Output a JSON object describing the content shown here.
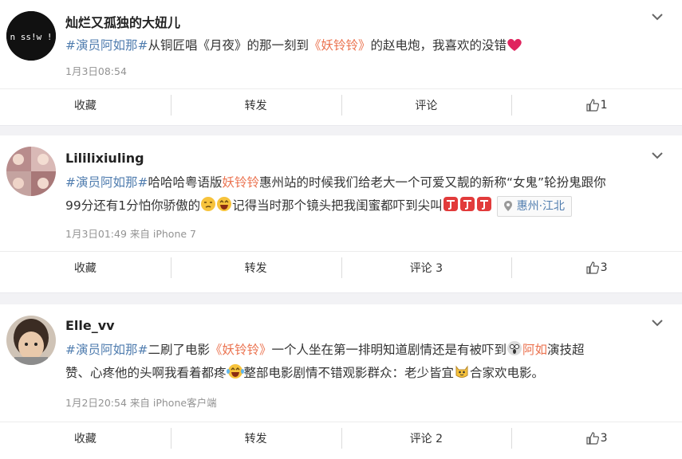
{
  "posts": [
    {
      "username": "灿烂又孤独的大妞儿",
      "avatar_text": "n ss!w !",
      "content": {
        "tag": "#演员阿如那#",
        "text": "从铜匠唱《月夜》的那一刻到",
        "movie": "《妖铃铃》",
        "text2": "的赵电炮，我喜欢的没错"
      },
      "meta": "1月3日08:54",
      "actions": {
        "favorite": "收藏",
        "repost": "转发",
        "comment": "评论",
        "like_count": "1"
      }
    },
    {
      "username": "Lililixiuling",
      "content": {
        "tag": "#演员阿如那#",
        "text_a": "哈哈哈粤语版",
        "movie": "妖铃铃",
        "text_b": "惠州站的时候我们给老大一个可爱又靓的新称“女鬼”轮扮鬼跟你",
        "text_c": "99分还有1分怕你骄傲的",
        "text_d": "记得当时那个镜头把我闺蜜都吓到尖叫",
        "location": "惠州·江北"
      },
      "meta": "1月3日01:49 来自 iPhone 7",
      "actions": {
        "favorite": "收藏",
        "repost": "转发",
        "comment": "评论 3",
        "like_count": "3"
      }
    },
    {
      "username": "Elle_vv",
      "content": {
        "tag": "#演员阿如那#",
        "text_a": "二刷了电影",
        "movie": "《妖铃铃》",
        "text_b": "一个人坐在第一排明知道剧情还是有被吓到",
        "name": "阿如",
        "text_c": "演技超",
        "text_d": "赞、心疼他的头啊我看着都疼",
        "text_e": "整部电影剧情不错观影群众：老少皆宜",
        "text_f": "合家欢电影。"
      },
      "meta": "1月2日20:54 来自 iPhone客户端",
      "actions": {
        "favorite": "收藏",
        "repost": "转发",
        "comment": "评论 2",
        "like_count": "3"
      }
    }
  ],
  "colors": {
    "tag": "#eb7350",
    "link": "#507daf",
    "meta": "#939393",
    "heart": "#e0245e"
  },
  "icons": [
    "chevron-down-icon",
    "thumb-up-icon",
    "heart-emoji",
    "location-pin-icon"
  ]
}
